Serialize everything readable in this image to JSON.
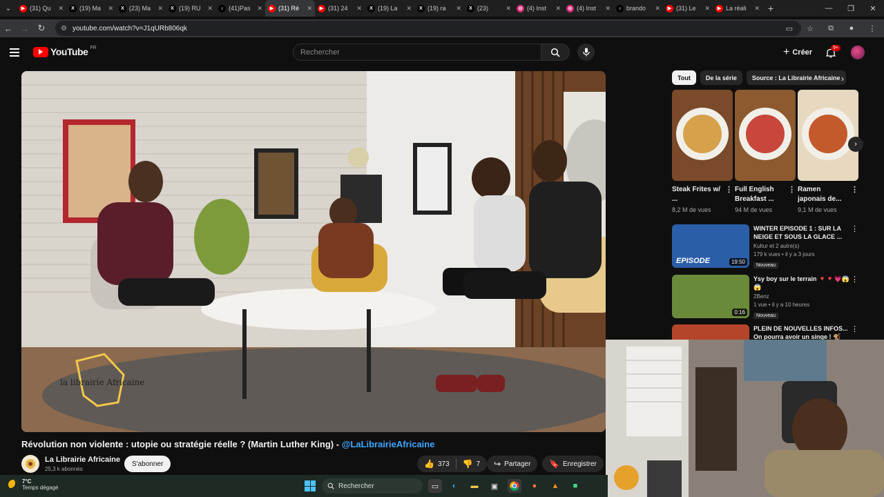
{
  "browser": {
    "tabs": [
      {
        "label": "(31) Qu",
        "icon": "youtube-icon",
        "color": "#ff0000",
        "active": false
      },
      {
        "label": "(19) Ma",
        "icon": "x-icon",
        "color": "#000000",
        "active": false
      },
      {
        "label": "(23) Ma",
        "icon": "x-icon",
        "color": "#000000",
        "active": false
      },
      {
        "label": "(19) RU",
        "icon": "x-icon",
        "color": "#000000",
        "active": false
      },
      {
        "label": "(41)Pas",
        "icon": "tiktok-icon",
        "color": "#000000",
        "active": false
      },
      {
        "label": "(31) Ré",
        "icon": "youtube-icon",
        "color": "#ff0000",
        "active": true
      },
      {
        "label": "(31) 24",
        "icon": "youtube-icon",
        "color": "#ff0000",
        "active": false
      },
      {
        "label": "(19) La",
        "icon": "x-icon",
        "color": "#000000",
        "active": false
      },
      {
        "label": "(19) ra",
        "icon": "x-icon",
        "color": "#000000",
        "active": false
      },
      {
        "label": "(23)",
        "icon": "x-icon",
        "color": "#000000",
        "active": false
      },
      {
        "label": "(4) Inst",
        "icon": "instagram-icon",
        "color": "#d62976",
        "active": false
      },
      {
        "label": "(4) Inst",
        "icon": "instagram-icon",
        "color": "#d62976",
        "active": false
      },
      {
        "label": "brando",
        "icon": "tiktok-icon",
        "color": "#000000",
        "active": false
      },
      {
        "label": "(31) Le",
        "icon": "youtube-icon",
        "color": "#ff0000",
        "active": false
      },
      {
        "label": "La réali",
        "icon": "youtube-icon",
        "color": "#ff0000",
        "active": false
      }
    ],
    "url": "youtube.com/watch?v=J1qURb806qk"
  },
  "header": {
    "logo_text": "YouTube",
    "region": "FR",
    "search_placeholder": "Rechercher",
    "create_label": "Créer",
    "notif_badge": "9+"
  },
  "video": {
    "title": "Révolution non violente : utopie ou stratégie réelle ? (Martin Luther King) - ",
    "handle": "@LaLibrairieAfricaine",
    "watermark": "la librairie Africaine"
  },
  "channel": {
    "name": "La Librairie Africaine",
    "subscribers": "25,3 k abonnés",
    "subscribe_label": "S'abonner"
  },
  "actions": {
    "likes": "373",
    "dislikes": "7",
    "share_label": "Partager",
    "save_label": "Enregistrer"
  },
  "chips": [
    {
      "label": "Tout",
      "active": true
    },
    {
      "label": "De la série",
      "active": false
    },
    {
      "label": "Source : La Librairie Africaine",
      "active": false
    }
  ],
  "shorts": [
    {
      "title": "Steak Frites w/ ...",
      "views": "8,2 M de vues"
    },
    {
      "title": "Full English Breakfast ...",
      "views": "94 M de vues"
    },
    {
      "title": "Ramen japonais de...",
      "views": "9,1 M de vues"
    }
  ],
  "recommendations": [
    {
      "title": "WINTER EPISODE 1 : SUR LA NEIGE ET SOUS LA GLACE ...",
      "channel": "Kultur et 2 autre(s)",
      "meta": "179 k vues • il y a 3 jours",
      "badge": "Nouveau",
      "duration": "19:50",
      "thumb_text": "EPISODE"
    },
    {
      "title": "Ysy boy sur le terrain 🔻🔻💗😱😱",
      "channel": "2Benz",
      "meta": "1 vue • il y a 10 heures",
      "badge": "Nouveau",
      "duration": "0:16",
      "thumb_text": ""
    },
    {
      "title": "PLEIN DE NOUVELLES INFOS... On pourra avoir un singe ! 🐒",
      "channel": "",
      "meta": "",
      "badge": "",
      "duration": "",
      "thumb_text": ""
    }
  ],
  "taskbar": {
    "temperature": "7°C",
    "condition": "Temps dégagé",
    "search_label": "Rechercher"
  }
}
